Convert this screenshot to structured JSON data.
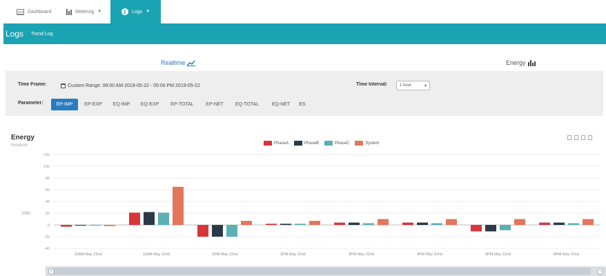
{
  "nav": {
    "tabs": [
      {
        "label": "Dashboard",
        "icon": "grid-icon"
      },
      {
        "label": "Metering",
        "icon": "bar-chart-icon"
      },
      {
        "label": "Logs",
        "icon": "info-icon"
      }
    ]
  },
  "header": {
    "title": "Logs",
    "subtitle": "Trend Log"
  },
  "modes": {
    "realtime": "Realtime",
    "energy": "Energy"
  },
  "controls": {
    "time_frame_label": "Time Frame:",
    "range_text": "Custom Range: 08:00 AM 2019-05-22 - 05:00 PM 2019-05-22",
    "time_interval_label": "Time Interval:",
    "interval_value": "1 hour",
    "parameter_label": "Parameter:",
    "parameters": [
      "EP-IMP",
      "EP-EXP",
      "EQ-IMP",
      "EQ-EXP",
      "EP-TOTAL",
      "EP-NET",
      "EQ-TOTAL",
      "EQ-NET",
      "ES"
    ],
    "active_parameter": "EP-IMP"
  },
  "chart_data": {
    "type": "bar",
    "title": "Energy",
    "subtitle": "Realtime",
    "ylabel": "kWh",
    "ylim": [
      -40,
      120
    ],
    "yticks": [
      -40,
      -20,
      0,
      20,
      40,
      60,
      80,
      100,
      120
    ],
    "categories": [
      "10AM May 22nd",
      "11AM May 22nd",
      "1PM May 22nd",
      "2PM May 22nd",
      "3PM May 22nd",
      "4PM May 22nd",
      "5PM May 22nd",
      "6PM May 22nd"
    ],
    "series": [
      {
        "name": "PhaseA",
        "color": "#d8353b",
        "values": [
          -3,
          21,
          -20,
          2,
          4,
          4,
          -11,
          4
        ]
      },
      {
        "name": "PhaseB",
        "color": "#2b3a46",
        "values": [
          0,
          22,
          -20,
          2,
          4,
          4,
          -11,
          4
        ]
      },
      {
        "name": "PhaseC",
        "color": "#5bb0b4",
        "values": [
          0,
          21,
          -20,
          2,
          3,
          3,
          -9,
          3
        ]
      },
      {
        "name": "System",
        "color": "#e2775d",
        "values": [
          -2,
          65,
          7,
          7,
          10,
          10,
          10,
          10
        ]
      }
    ],
    "legend_position": "top-center",
    "grid": true
  }
}
